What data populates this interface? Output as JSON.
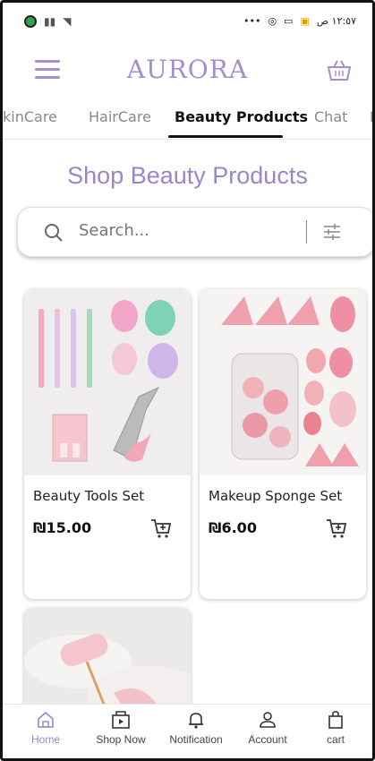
{
  "status_bar": {
    "time": "١٢:٥٧ ص",
    "dots": "•••"
  },
  "header": {
    "brand": "AURORA"
  },
  "tabs": [
    {
      "label": "kinCare"
    },
    {
      "label": "HairCare"
    },
    {
      "label": "Beauty Products"
    },
    {
      "label": "Chat"
    },
    {
      "label": "F"
    }
  ],
  "page_title": "Shop Beauty Products",
  "search": {
    "placeholder": "Search..."
  },
  "products": [
    {
      "name": "Beauty Tools Set",
      "price": "₪15.00"
    },
    {
      "name": "Makeup Sponge Set",
      "price": "₪6.00"
    },
    {
      "name": "",
      "price": ""
    }
  ],
  "bottom_nav": [
    {
      "label": "Home",
      "icon": "home-icon"
    },
    {
      "label": "Shop Now",
      "icon": "shop-now-icon"
    },
    {
      "label": "Notification",
      "icon": "bell-icon"
    },
    {
      "label": "Account",
      "icon": "account-icon"
    },
    {
      "label": "cart",
      "icon": "bag-icon"
    }
  ],
  "colors": {
    "accent": "#9a86cc",
    "text": "#222222"
  }
}
